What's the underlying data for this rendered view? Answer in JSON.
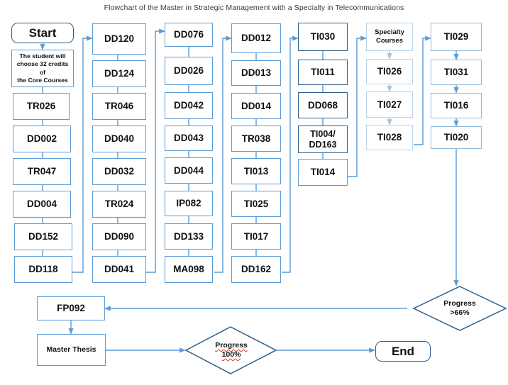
{
  "title": "Flowchart of the Master in Strategic Management with a Specialty in Telecommunications",
  "colors": {
    "connector": "#5b9bd5",
    "node_border": "#5b9bd5",
    "node_border_dark": "#2e5f8a",
    "node_border_pale": "#b7d3ec",
    "diamond_border": "#2e5f8a",
    "background": "#ffffff",
    "text": "#111111",
    "spellcheck_underline": "#e04a3f"
  },
  "columns": [
    {
      "name": "core-courses-column-1",
      "nodes": [
        {
          "id": "start",
          "label": "Start",
          "shape": "terminator"
        },
        {
          "id": "instruction",
          "label": "The student will choose 32 credits of the Core Courses",
          "shape": "process"
        },
        {
          "id": "tr026",
          "label": "TR026",
          "shape": "process"
        },
        {
          "id": "dd002",
          "label": "DD002",
          "shape": "process"
        },
        {
          "id": "tr047",
          "label": "TR047",
          "shape": "process"
        },
        {
          "id": "dd004",
          "label": "DD004",
          "shape": "process"
        },
        {
          "id": "dd152",
          "label": "DD152",
          "shape": "process"
        },
        {
          "id": "dd118",
          "label": "DD118",
          "shape": "process"
        }
      ]
    },
    {
      "name": "core-courses-column-2",
      "nodes": [
        {
          "id": "dd120",
          "label": "DD120",
          "shape": "process"
        },
        {
          "id": "dd124",
          "label": "DD124",
          "shape": "process"
        },
        {
          "id": "tr046",
          "label": "TR046",
          "shape": "process"
        },
        {
          "id": "dd040",
          "label": "DD040",
          "shape": "process"
        },
        {
          "id": "dd032",
          "label": "DD032",
          "shape": "process"
        },
        {
          "id": "tr024",
          "label": "TR024",
          "shape": "process"
        },
        {
          "id": "dd090",
          "label": "DD090",
          "shape": "process"
        },
        {
          "id": "dd041",
          "label": "DD041",
          "shape": "process"
        }
      ]
    },
    {
      "name": "core-courses-column-3",
      "nodes": [
        {
          "id": "dd076",
          "label": "DD076",
          "shape": "process"
        },
        {
          "id": "dd026",
          "label": "DD026",
          "shape": "process"
        },
        {
          "id": "dd042",
          "label": "DD042",
          "shape": "process"
        },
        {
          "id": "dd043",
          "label": "DD043",
          "shape": "process"
        },
        {
          "id": "dd044",
          "label": "DD044",
          "shape": "process"
        },
        {
          "id": "ip082",
          "label": "IP082",
          "shape": "process"
        },
        {
          "id": "dd133",
          "label": "DD133",
          "shape": "process"
        },
        {
          "id": "ma098",
          "label": "MA098",
          "shape": "process"
        }
      ]
    },
    {
      "name": "core-courses-column-4",
      "nodes": [
        {
          "id": "dd012",
          "label": "DD012",
          "shape": "process"
        },
        {
          "id": "dd013",
          "label": "DD013",
          "shape": "process"
        },
        {
          "id": "dd014",
          "label": "DD014",
          "shape": "process"
        },
        {
          "id": "tr038",
          "label": "TR038",
          "shape": "process"
        },
        {
          "id": "ti013",
          "label": "TI013",
          "shape": "process"
        },
        {
          "id": "ti025",
          "label": "TI025",
          "shape": "process"
        },
        {
          "id": "ti017",
          "label": "TI017",
          "shape": "process"
        },
        {
          "id": "dd162",
          "label": "DD162",
          "shape": "process"
        }
      ]
    },
    {
      "name": "core-courses-column-5",
      "nodes": [
        {
          "id": "ti030",
          "label": "TI030",
          "shape": "process"
        },
        {
          "id": "ti011",
          "label": "TI011",
          "shape": "process"
        },
        {
          "id": "dd068",
          "label": "DD068",
          "shape": "process"
        },
        {
          "id": "ti004_dd163",
          "label": "TI004/ DD163",
          "shape": "process"
        },
        {
          "id": "ti014",
          "label": "TI014",
          "shape": "process"
        }
      ]
    },
    {
      "name": "specialty-courses-column-6",
      "nodes": [
        {
          "id": "specialty",
          "label": "Specialty Courses",
          "shape": "process"
        },
        {
          "id": "ti026",
          "label": "TI026",
          "shape": "process"
        },
        {
          "id": "ti027",
          "label": "TI027",
          "shape": "process"
        },
        {
          "id": "ti028",
          "label": "TI028",
          "shape": "process"
        }
      ]
    },
    {
      "name": "specialty-courses-column-7",
      "nodes": [
        {
          "id": "ti029",
          "label": "TI029",
          "shape": "process"
        },
        {
          "id": "ti031",
          "label": "TI031",
          "shape": "process"
        },
        {
          "id": "ti016",
          "label": "TI016",
          "shape": "process"
        },
        {
          "id": "ti020",
          "label": "TI020",
          "shape": "process"
        }
      ]
    }
  ],
  "decisions": [
    {
      "id": "progress66",
      "line1": "Progress",
      "line2": ">66%"
    },
    {
      "id": "progress100",
      "line1": "Progress",
      "line2": "100%"
    }
  ],
  "bottom": {
    "fp092": "FP092",
    "master_thesis": "Master Thesis",
    "end": "End"
  },
  "instruction_lines": [
    "The student will",
    "choose 32 credits of",
    "the Core Courses"
  ],
  "specialty_lines": [
    "Specialty",
    "Courses"
  ],
  "ti004_lines": [
    "TI004/",
    "DD163"
  ]
}
